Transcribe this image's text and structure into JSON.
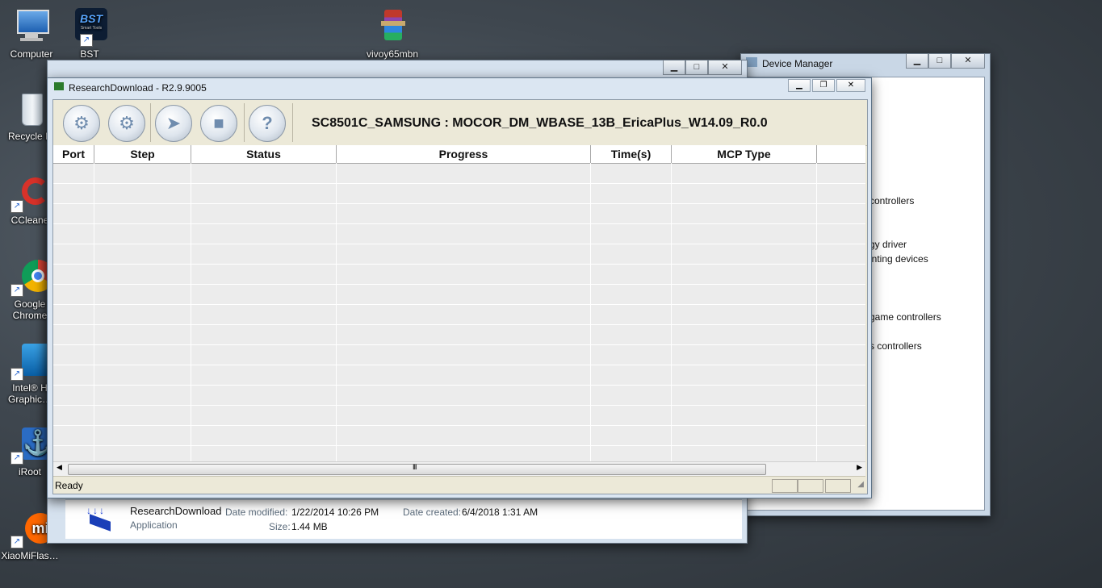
{
  "desktop": {
    "icons": [
      {
        "label": "Computer",
        "icon": "computer-icon"
      },
      {
        "label": "BST",
        "icon": "bst-app-icon"
      },
      {
        "label": "vivoy65mbn",
        "icon": "winrar-archive-icon"
      },
      {
        "label": "Recycle B",
        "icon": "recycle-bin-icon"
      },
      {
        "label": "CCleane",
        "icon": "ccleaner-icon"
      },
      {
        "label": "Google Chrome",
        "icon": "chrome-icon"
      },
      {
        "label": "Intel® H Graphic…",
        "icon": "intel-graphics-icon"
      },
      {
        "label": "iRoot",
        "icon": "iroot-icon"
      },
      {
        "label": "XiaoMiFlas…",
        "icon": "xiaomi-flash-icon"
      }
    ],
    "bst_sub": "Smart Tools"
  },
  "device_manager": {
    "title": "Device Manager",
    "partial_items": [
      "controllers",
      "gy driver",
      "inting devices",
      "game controllers",
      "s controllers"
    ]
  },
  "explorer": {
    "file_name": "ResearchDownload",
    "file_type": "Application",
    "modified_label": "Date modified:",
    "modified_value": "1/22/2014 10:26 PM",
    "created_label": "Date created:",
    "created_value": "6/4/2018 1:31 AM",
    "size_label": "Size:",
    "size_value": "1.44 MB"
  },
  "research_download": {
    "title": "ResearchDownload - R2.9.9005",
    "firmware": "SC8501C_SAMSUNG : MOCOR_DM_WBASE_13B_EricaPlus_W14.09_R0.0",
    "toolbar": [
      "gear-icon",
      "gears-icon",
      "play-arrow-icon",
      "stop-icon",
      "help-icon"
    ],
    "columns": [
      "Port",
      "Step",
      "Status",
      "Progress",
      "Time(s)",
      "MCP Type"
    ],
    "status": "Ready",
    "scroll_mid": "III"
  }
}
